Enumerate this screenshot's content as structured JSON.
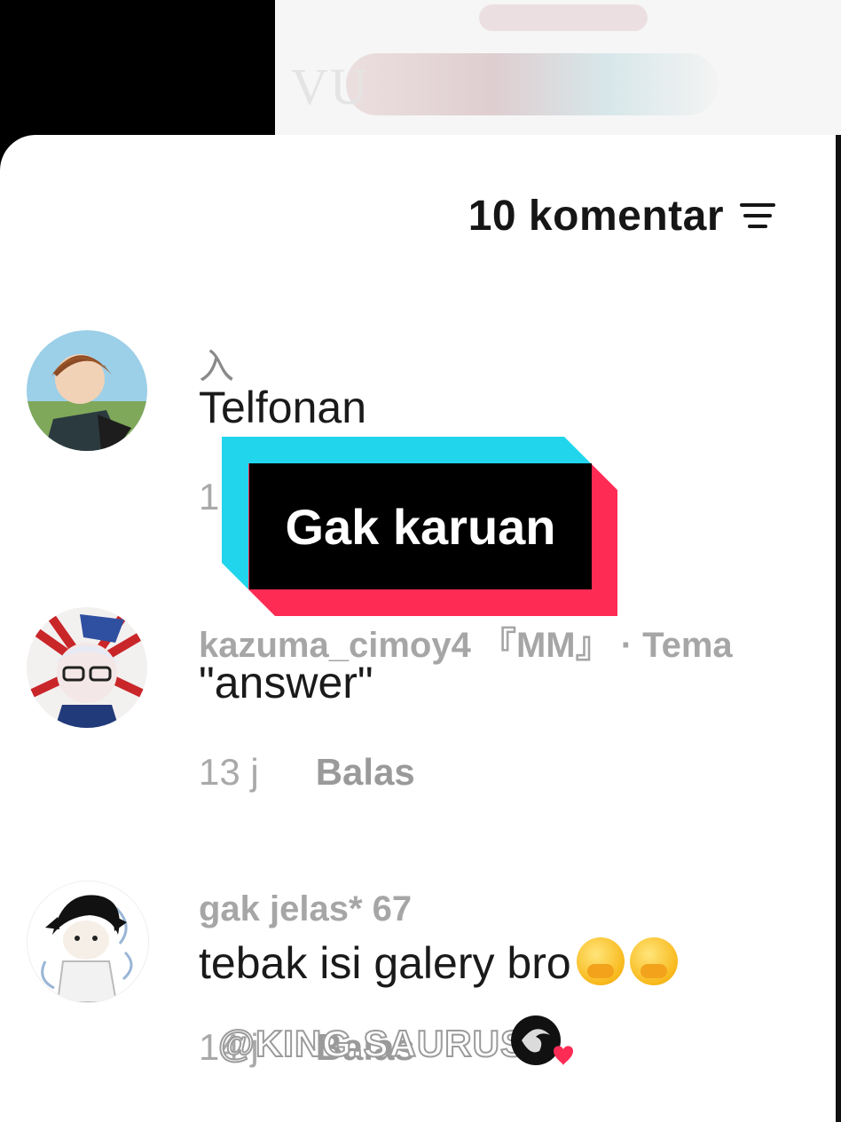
{
  "header": {
    "comment_count": "10 komentar",
    "sort_icon": "sort-filter-icon"
  },
  "comments": [
    {
      "username": "入",
      "text": "Telfonan",
      "time": "1",
      "reply": ""
    },
    {
      "username": "kazuma_cimoy4 『MM』 · Tema",
      "text": "\"answer\"",
      "time": "13 j",
      "reply": "Balas"
    },
    {
      "username": "gak jelas* 67",
      "text": "tebak isi galery bro",
      "time": "14 j",
      "reply": "Balas"
    }
  ],
  "sticker": {
    "text": "Gak karuan"
  },
  "watermark": {
    "text": "@KING.SAURUS"
  },
  "colors": {
    "cyan": "#20d5ec",
    "red": "#fe2c55",
    "text_muted": "#a6a6a6"
  }
}
